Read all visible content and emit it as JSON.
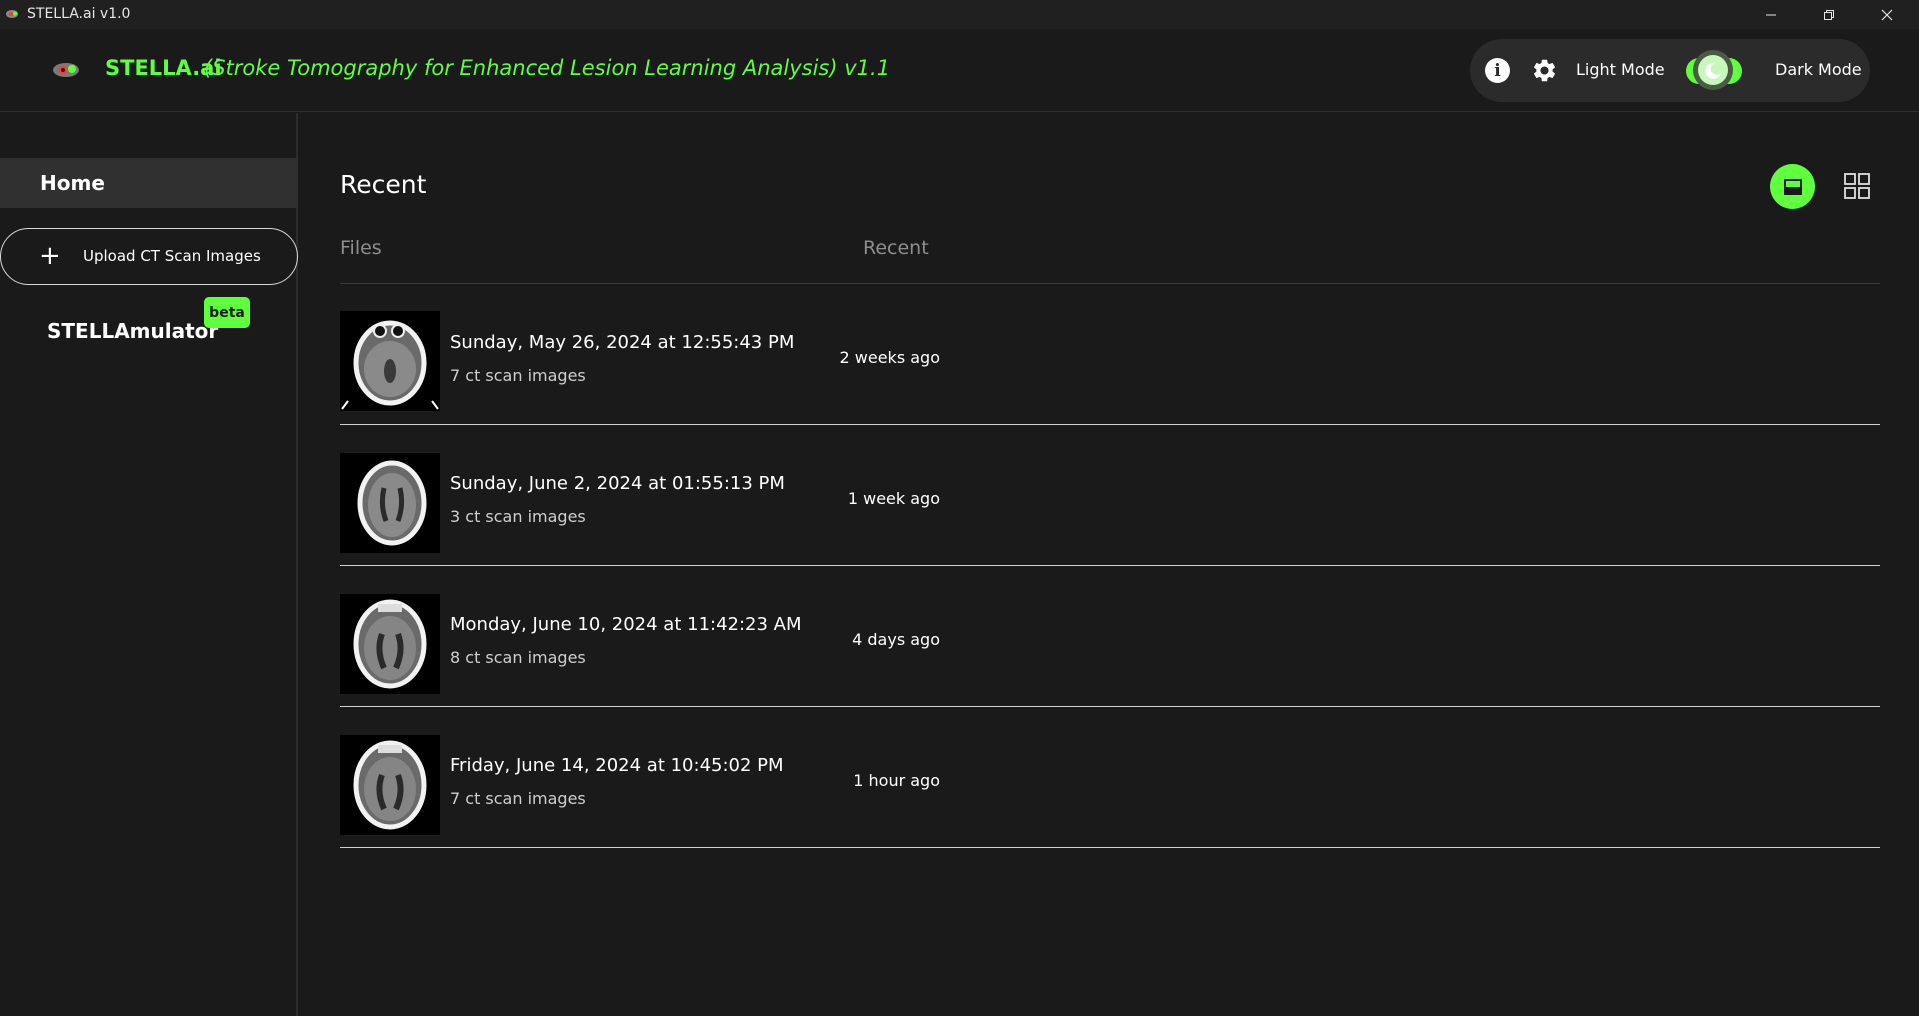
{
  "window": {
    "title": "STELLA.ai v1.0"
  },
  "header": {
    "brand": "STELLA.ai",
    "subtitle": "(Stroke Tomography for Enhanced Lesion Learning Analysis) v1.1",
    "light_mode_label": "Light Mode",
    "dark_mode_label": "Dark Mode",
    "dark_mode_enabled": true,
    "info_glyph": "i"
  },
  "sidebar": {
    "home_label": "Home",
    "upload_label": "Upload CT Scan Images",
    "upload_glyph": "+",
    "stellamulator_label": "STELLAmulator",
    "beta_badge": "beta"
  },
  "main": {
    "title": "Recent",
    "columns": {
      "files": "Files",
      "recent": "Recent"
    },
    "view_mode": "list",
    "items": [
      {
        "title": "Sunday, May 26, 2024 at 12:55:43 PM",
        "subtitle": "7 ct scan images",
        "ago": "2 weeks ago"
      },
      {
        "title": "Sunday, June 2, 2024 at 01:55:13 PM",
        "subtitle": "3 ct scan images",
        "ago": "1 week ago"
      },
      {
        "title": "Monday, June 10, 2024 at 11:42:23 AM",
        "subtitle": "8 ct scan images",
        "ago": "4 days ago"
      },
      {
        "title": "Friday, June 14, 2024 at 10:45:02 PM",
        "subtitle": "7 ct scan images",
        "ago": "1 hour ago"
      }
    ]
  },
  "colors": {
    "accent": "#5fff3e",
    "background": "#1a1a1a",
    "panel": "#2b2b2b"
  },
  "icons": {
    "app": "stella-logo-icon",
    "info": "info-icon",
    "settings": "gear-icon",
    "list_view": "list-view-icon",
    "grid_view": "grid-view-icon",
    "minimize": "minimize-icon",
    "maximize": "restore-icon",
    "close": "close-icon"
  }
}
